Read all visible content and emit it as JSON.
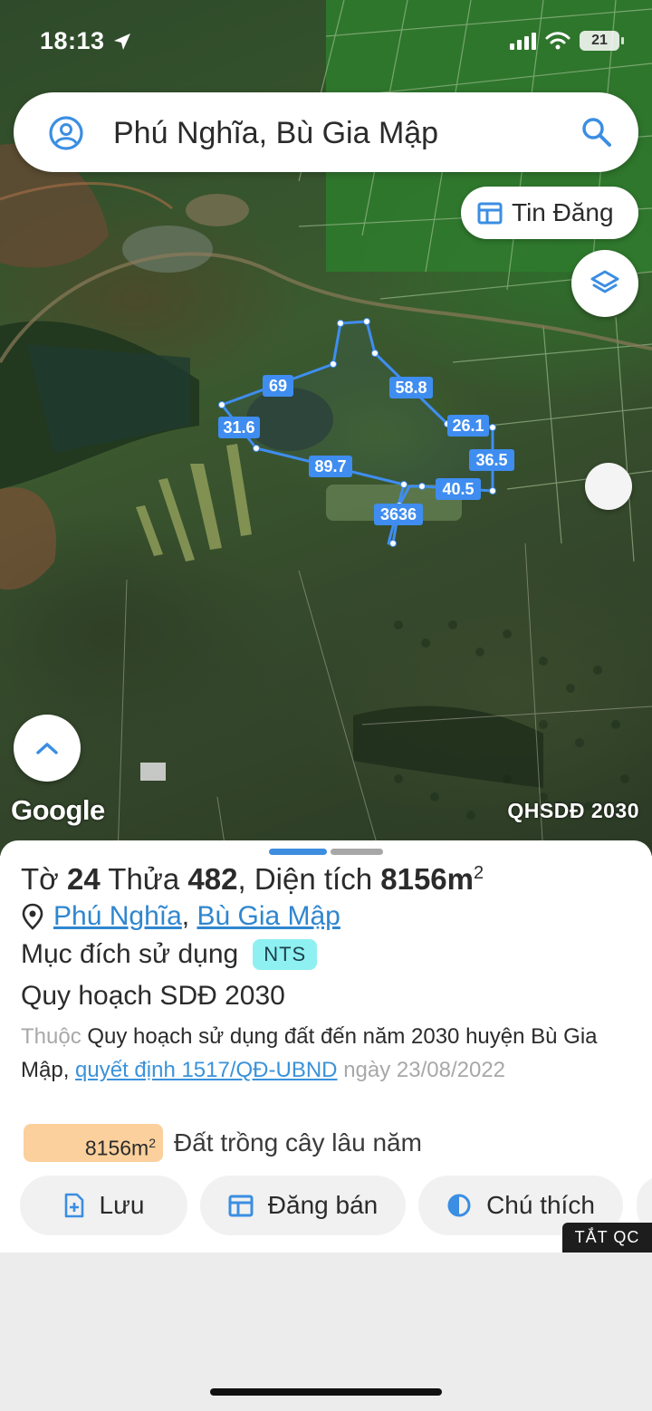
{
  "status_bar": {
    "time": "18:13",
    "battery": "21"
  },
  "search": {
    "value": "Phú Nghĩa, Bù Gia Mập",
    "placeholder": ""
  },
  "listing_button": {
    "label": "Tin Đăng"
  },
  "map": {
    "attribution": "Google",
    "layer_label": "QHSDĐ 2030",
    "edge_lengths": [
      "69",
      "58.8",
      "31.6",
      "26.1",
      "89.7",
      "36.5",
      "40.5",
      "3636"
    ]
  },
  "parcel": {
    "title_prefix": "Tờ",
    "sheet_no": "24",
    "plot_label": "Thửa",
    "plot_no": "482",
    "area_label": ", Diện tích",
    "area_value": "8156m",
    "area_sup": "2",
    "commune": "Phú Nghĩa",
    "district": "Bù Gia Mập",
    "purpose_label": "Mục đích sử dụng",
    "purpose_code": "NTS",
    "plan_title": "Quy hoạch SDĐ 2030",
    "plan_prefix": "Thuộc",
    "plan_name": "Quy hoạch sử dụng đất đến năm 2030 huyện Bù Gia Mập,",
    "decision_link": "quyết định 1517/QĐ-UBND",
    "date_prefix": "ngày",
    "date": "23/08/2022",
    "legend_area": "8156m",
    "legend_area_sup": "2",
    "legend_text": "Đất trồng cây lâu năm",
    "legend_color": "#fbd09c"
  },
  "actions": {
    "save": "Lưu",
    "post": "Đăng bán",
    "legend": "Chú thích"
  },
  "ad_toggle": "TẮT QC",
  "colors": {
    "accent": "#2f86cf",
    "parcel_line": "#3f8df0",
    "badge": "#8ff0f2"
  }
}
